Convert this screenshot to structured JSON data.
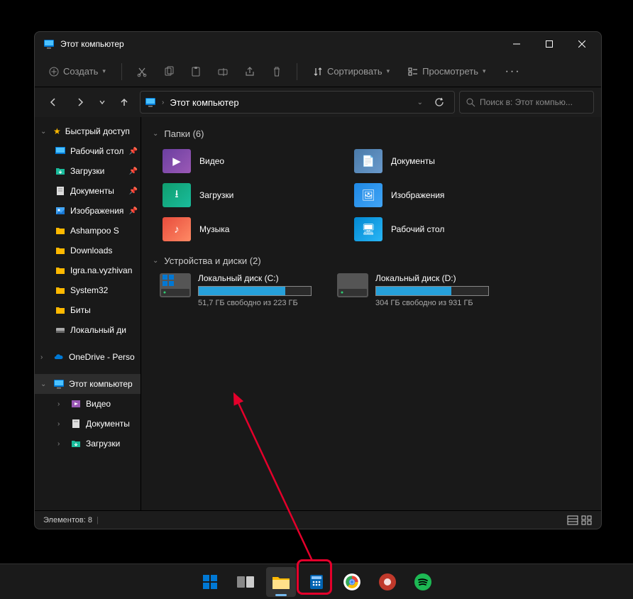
{
  "window": {
    "title": "Этот компьютер"
  },
  "toolbar": {
    "create": "Создать",
    "sort": "Сортировать",
    "view": "Просмотреть"
  },
  "addressbar": {
    "path": "Этот компьютер"
  },
  "search": {
    "placeholder": "Поиск в: Этот компью..."
  },
  "sidebar": {
    "quick_access": "Быстрый доступ",
    "items": [
      {
        "label": "Рабочий стол"
      },
      {
        "label": "Загрузки"
      },
      {
        "label": "Документы"
      },
      {
        "label": "Изображения"
      },
      {
        "label": "Ashampoo S"
      },
      {
        "label": "Downloads"
      },
      {
        "label": "Igra.na.vyzhivan"
      },
      {
        "label": "System32"
      },
      {
        "label": "Биты"
      },
      {
        "label": "Локальный ди"
      }
    ],
    "onedrive": "OneDrive - Perso",
    "this_pc": "Этот компьютер",
    "pc_items": [
      {
        "label": "Видео"
      },
      {
        "label": "Документы"
      },
      {
        "label": "Загрузки"
      }
    ]
  },
  "main": {
    "folders_header": "Папки (6)",
    "folders": [
      {
        "name": "Видео",
        "bg1": "#6b3fa0",
        "bg2": "#9b59b6",
        "glyph": "▶"
      },
      {
        "name": "Документы",
        "bg1": "#4a7aa8",
        "bg2": "#6a9acc",
        "glyph": "📄"
      },
      {
        "name": "Загрузки",
        "bg1": "#0f9d6e",
        "bg2": "#1abc9c",
        "glyph": "⭳"
      },
      {
        "name": "Изображения",
        "bg1": "#1e88e5",
        "bg2": "#42a5f5",
        "glyph": "🖼"
      },
      {
        "name": "Музыка",
        "bg1": "#e74c3c",
        "bg2": "#ff8a65",
        "glyph": "♪"
      },
      {
        "name": "Рабочий стол",
        "bg1": "#0288d1",
        "bg2": "#29b6f6",
        "glyph": "🖥"
      }
    ],
    "drives_header": "Устройства и диски (2)",
    "drives": [
      {
        "name": "Локальный диск (C:)",
        "free": "51,7 ГБ свободно из 223 ГБ",
        "fill": 77
      },
      {
        "name": "Локальный диск (D:)",
        "free": "304 ГБ свободно из 931 ГБ",
        "fill": 67
      }
    ]
  },
  "status": {
    "count": "Элементов: 8"
  }
}
